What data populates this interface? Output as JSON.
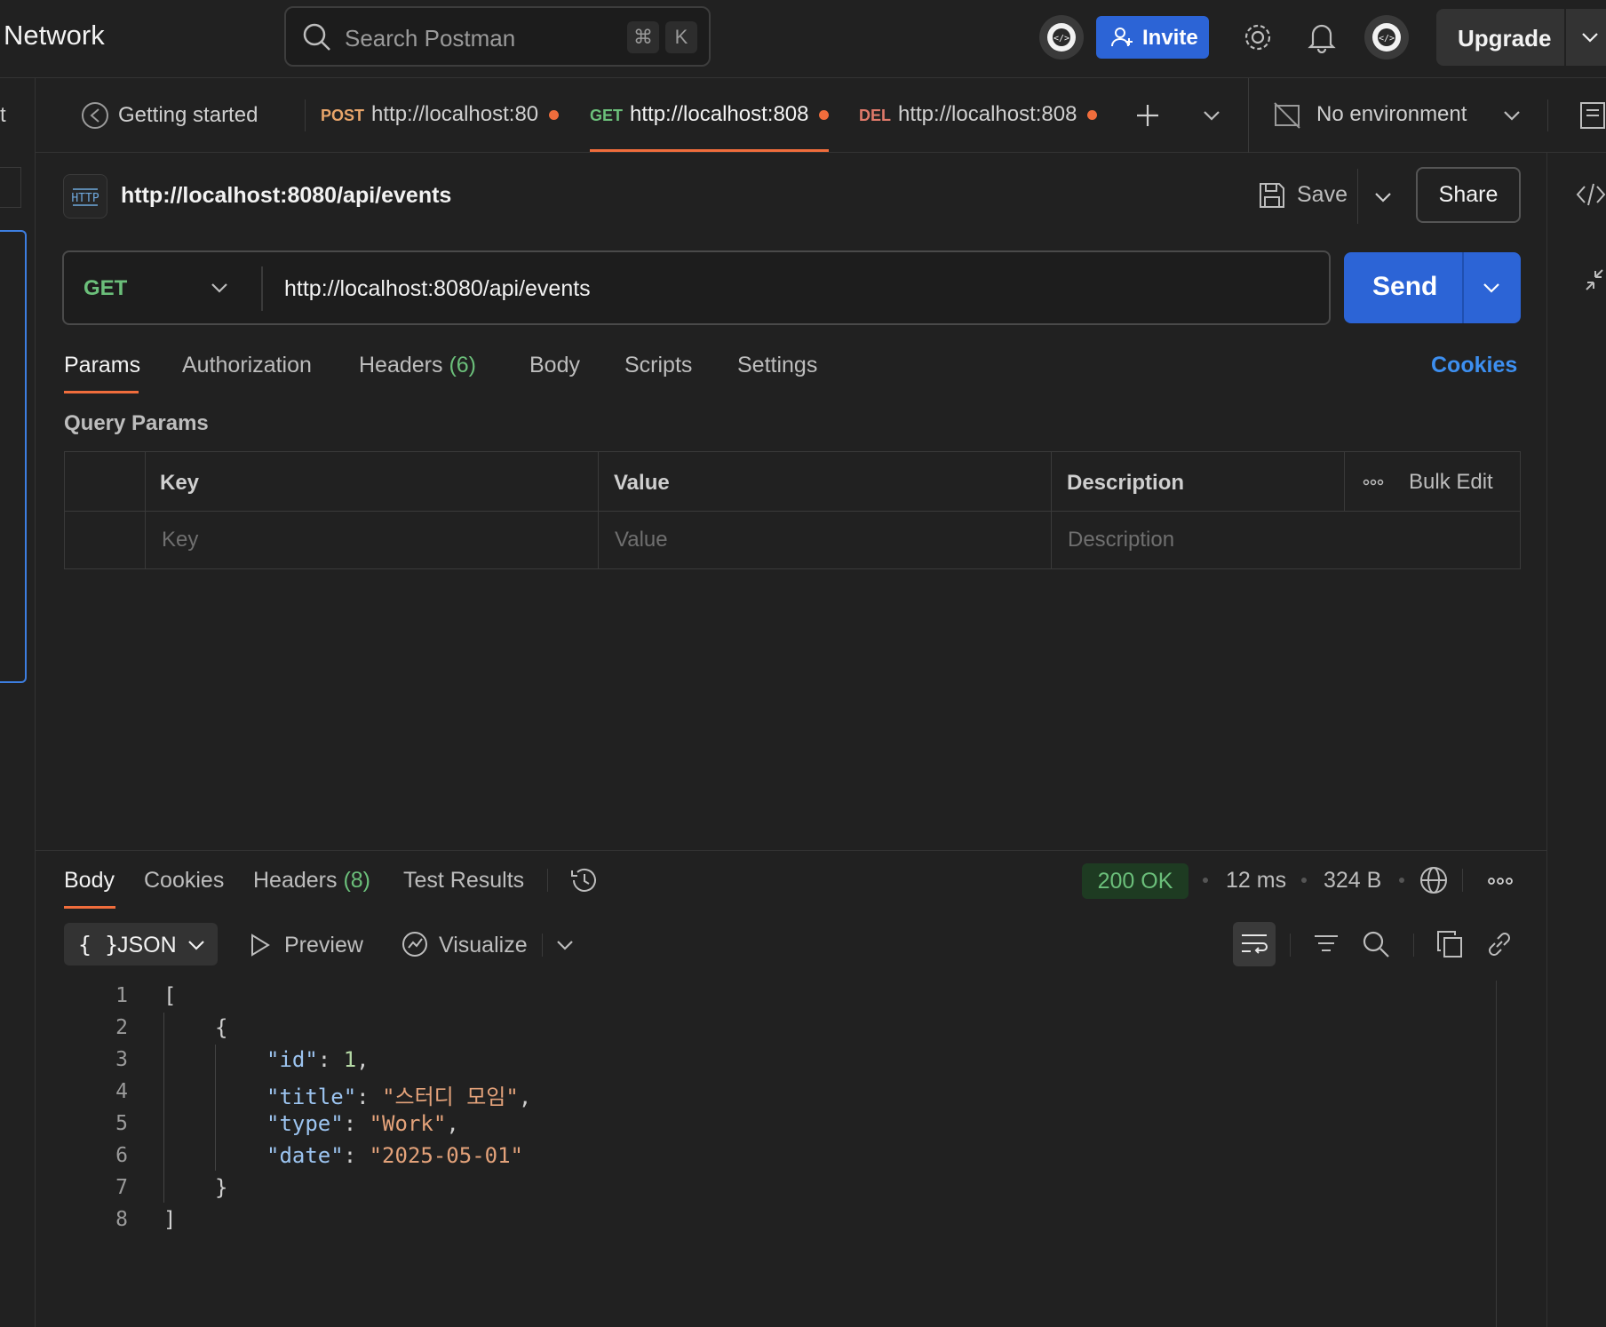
{
  "app": {
    "title": "Network"
  },
  "search": {
    "placeholder": "Search Postman",
    "kbd1": "⌘",
    "kbd2": "K"
  },
  "header": {
    "invite_label": "Invite",
    "upgrade_label": "Upgrade"
  },
  "left_strip": {
    "partial_label": "t"
  },
  "tabs": [
    {
      "method": "",
      "label": "Getting started"
    },
    {
      "method": "POST",
      "label": "http://localhost:80",
      "method_color": "#e8a56a"
    },
    {
      "method": "GET",
      "label": "http://localhost:808",
      "method_color": "#6bbf7a"
    },
    {
      "method": "DEL",
      "label": "http://localhost:808",
      "method_color": "#e07a6a"
    }
  ],
  "environment": {
    "label": "No environment"
  },
  "request": {
    "title": "http://localhost:8080/api/events",
    "save_label": "Save",
    "share_label": "Share",
    "method": "GET",
    "url": "http://localhost:8080/api/events",
    "send_label": "Send",
    "badge": "HTTP"
  },
  "request_tabs": {
    "params": "Params",
    "authorization": "Authorization",
    "headers": "Headers",
    "headers_count": "(6)",
    "body": "Body",
    "scripts": "Scripts",
    "settings": "Settings",
    "cookies": "Cookies"
  },
  "query_params": {
    "title": "Query Params",
    "headers": {
      "key": "Key",
      "value": "Value",
      "description": "Description",
      "bulk_edit": "Bulk Edit"
    },
    "placeholders": {
      "key": "Key",
      "value": "Value",
      "description": "Description"
    }
  },
  "response": {
    "tabs": {
      "body": "Body",
      "cookies": "Cookies",
      "headers": "Headers",
      "headers_count": "(8)",
      "test_results": "Test Results"
    },
    "status": "200 OK",
    "time": "12 ms",
    "size": "324 B",
    "format": "JSON",
    "preview_label": "Preview",
    "visualize_label": "Visualize",
    "lines": [
      "1",
      "2",
      "3",
      "4",
      "5",
      "6",
      "7",
      "8"
    ],
    "json": {
      "open_bracket": "[",
      "open_brace": "{",
      "id_key": "\"id\"",
      "id_val": "1",
      "title_key": "\"title\"",
      "title_val": "\"스터디 모임\"",
      "type_key": "\"type\"",
      "type_val": "\"Work\"",
      "date_key": "\"date\"",
      "date_val": "\"2025-05-01\"",
      "close_brace": "}",
      "close_bracket": "]"
    }
  },
  "colors": {
    "accent": "#f06d3c",
    "primary": "#2c64d6",
    "get_green": "#6bbf7a",
    "link_blue": "#3d8ff0"
  }
}
